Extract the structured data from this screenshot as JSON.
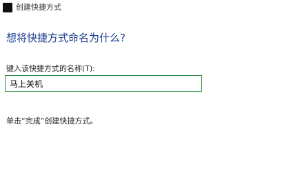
{
  "window": {
    "title": "创建快捷方式",
    "icon": "shortcut-icon"
  },
  "main": {
    "heading": "想将快捷方式命名为什么?",
    "name_label": "键入该快捷方式的名称(T):",
    "name_value": "马上关机",
    "hint": "单击“完成”创建快捷方式。"
  },
  "colors": {
    "heading": "#1a3d8f",
    "input_border": "#2b8a3e"
  }
}
